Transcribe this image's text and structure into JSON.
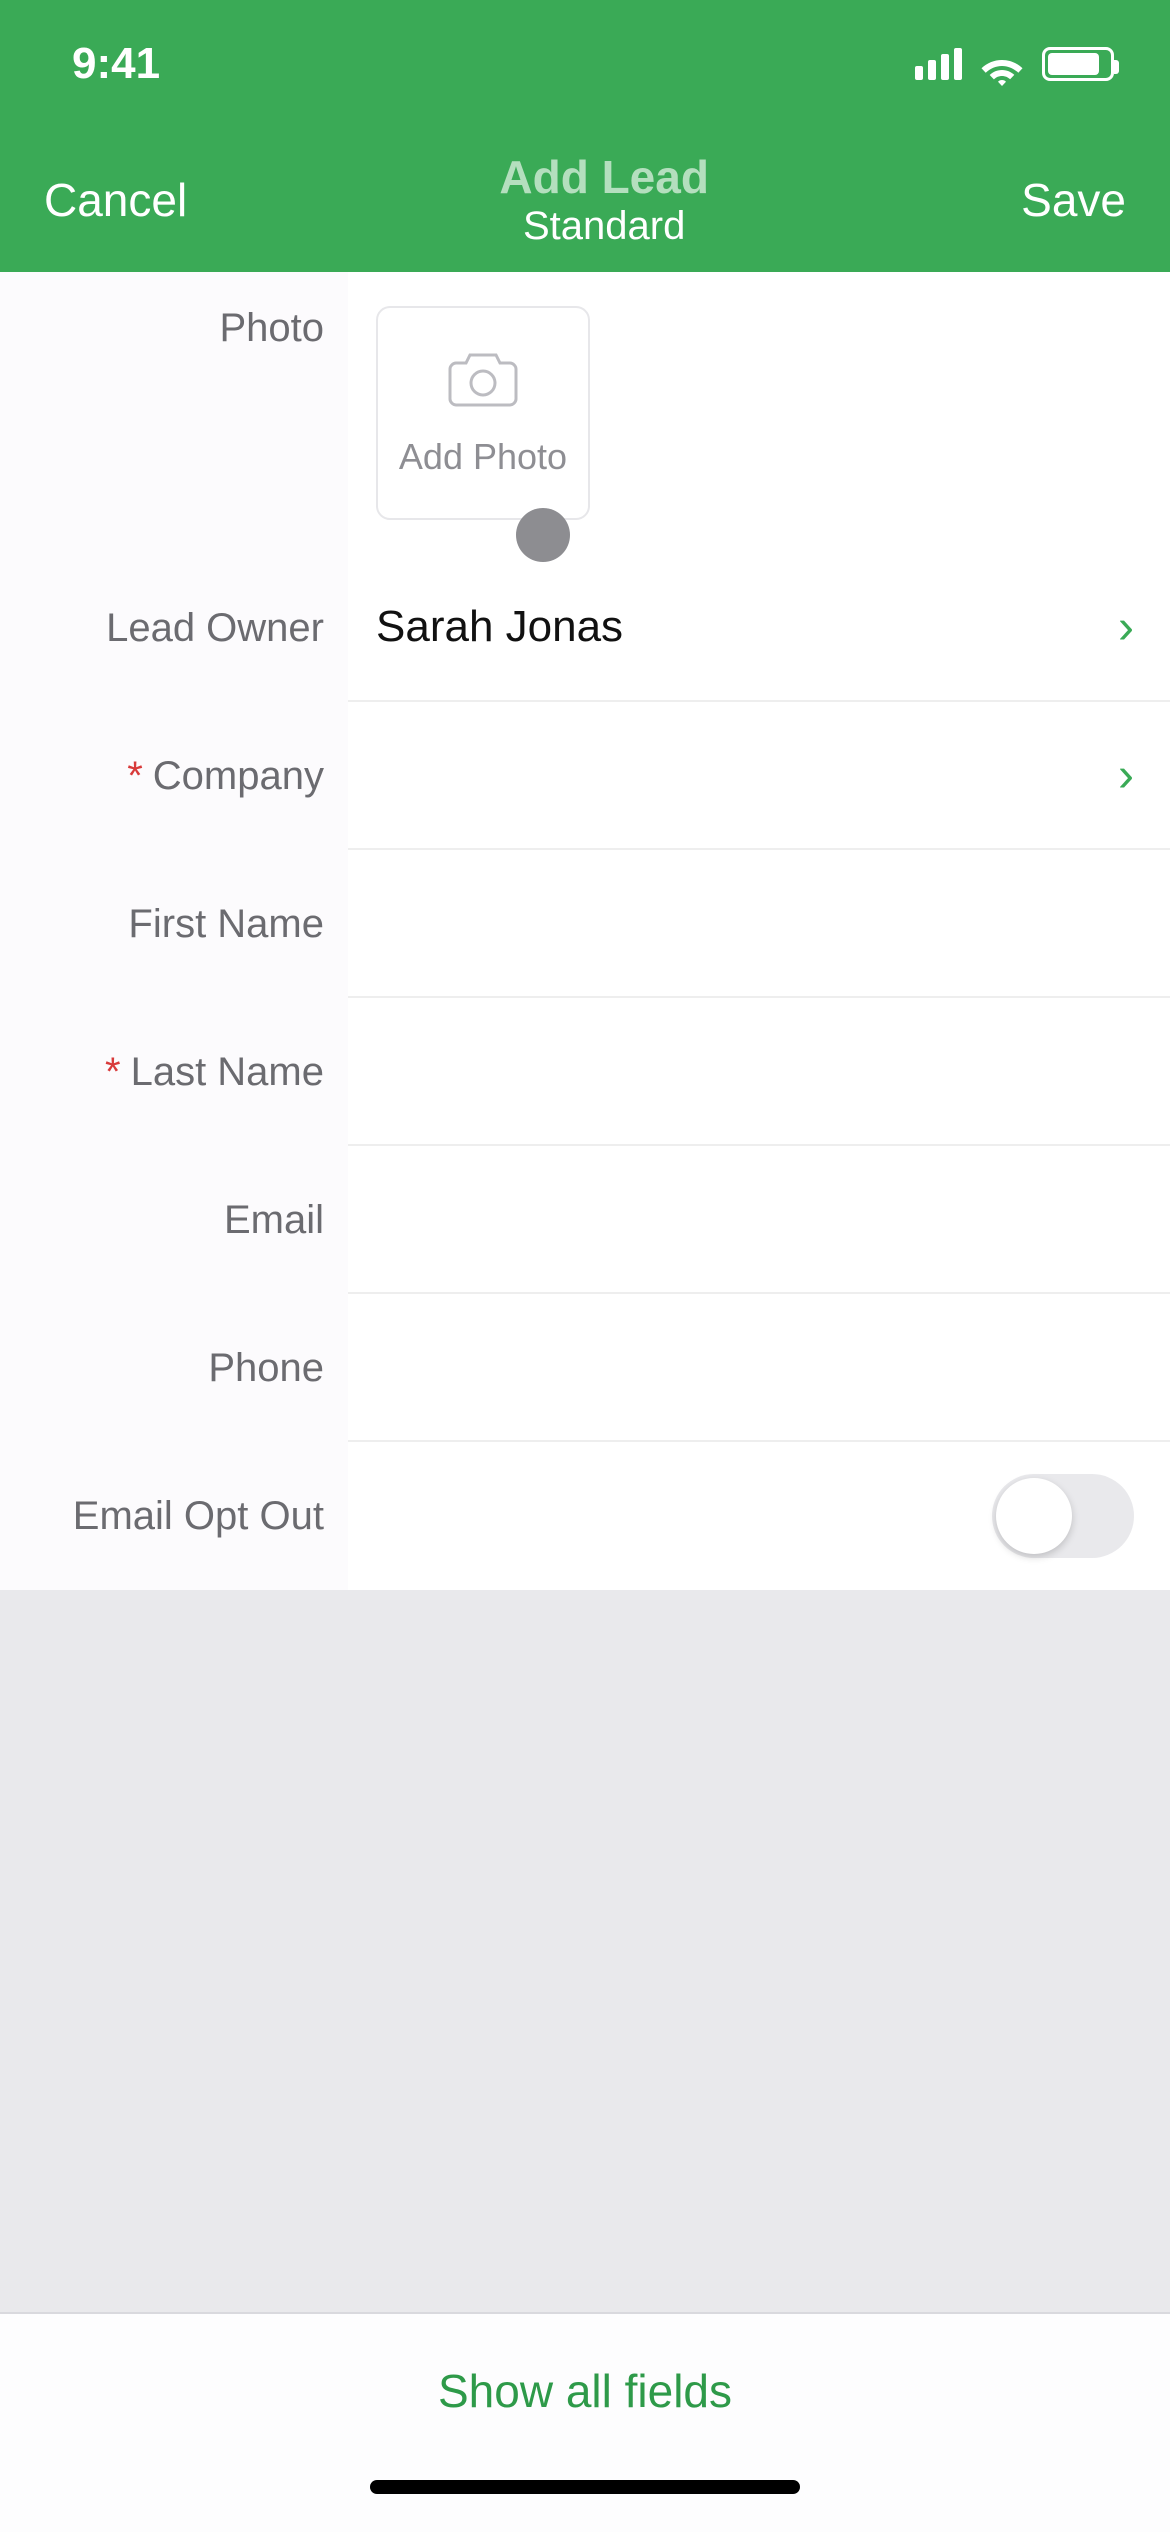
{
  "statusBar": {
    "time": "9:41"
  },
  "nav": {
    "cancel": "Cancel",
    "title": "Add Lead",
    "subtitle": "Standard",
    "save": "Save"
  },
  "photo": {
    "label": "Photo",
    "addLabel": "Add Photo"
  },
  "fields": {
    "leadOwner": {
      "label": "Lead Owner",
      "value": "Sarah Jonas",
      "required": false,
      "chevron": true
    },
    "company": {
      "label": "Company",
      "value": "",
      "required": true,
      "chevron": true
    },
    "firstName": {
      "label": "First Name",
      "value": "",
      "required": false,
      "chevron": false
    },
    "lastName": {
      "label": "Last Name",
      "value": "",
      "required": true,
      "chevron": false
    },
    "email": {
      "label": "Email",
      "value": "",
      "required": false,
      "chevron": false
    },
    "phone": {
      "label": "Phone",
      "value": "",
      "required": false,
      "chevron": false
    },
    "emailOptOut": {
      "label": "Email Opt Out",
      "on": false
    }
  },
  "footer": {
    "showAll": "Show all fields"
  },
  "requiredMark": "*"
}
